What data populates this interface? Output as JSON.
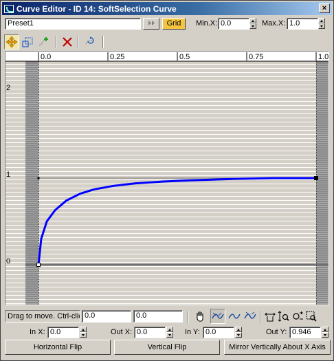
{
  "window": {
    "title": "Curve Editor - ID 14: SoftSelection Curve",
    "close_label": "×"
  },
  "top": {
    "preset": "Preset1",
    "grid_label": "Grid",
    "minx_label": "Min.X:",
    "minx_value": "0.0",
    "maxx_label": "Max.X:",
    "maxx_value": "1.0"
  },
  "toolbar": {
    "icons": [
      "move-icon",
      "scale-icon",
      "add-point-icon",
      "delete-icon",
      "reset-icon"
    ]
  },
  "graph": {
    "ruler_ticks": [
      "0.0",
      "0.25",
      "0.5",
      "0.75",
      "1.0"
    ],
    "y_labels": [
      "2",
      "1",
      "0"
    ],
    "curve_color": "#0000ff"
  },
  "chart_data": {
    "type": "line",
    "title": "",
    "xlabel": "",
    "ylabel": "",
    "xlim": [
      0,
      1
    ],
    "ylim": [
      -0.2,
      2.3
    ],
    "x_ticks": [
      "0.0",
      "0.25",
      "0.5",
      "0.75",
      "1.0"
    ],
    "y_ticks": [
      "0",
      "1",
      "2"
    ],
    "series": [
      {
        "x": [
          0,
          0.01,
          0.03,
          0.06,
          0.1,
          0.15,
          0.2,
          0.27,
          0.35,
          0.45,
          0.55,
          0.7,
          0.85,
          1.0
        ],
        "y": [
          0,
          0.3,
          0.5,
          0.63,
          0.74,
          0.82,
          0.87,
          0.91,
          0.94,
          0.96,
          0.975,
          0.99,
          1.0,
          1.0
        ]
      }
    ],
    "grid": true
  },
  "status": {
    "hint": "Drag to move. Ctrl-clic",
    "field1": "0.0",
    "field2": "0.0"
  },
  "points": {
    "inx_label": "In X:",
    "inx_value": "0.0",
    "outx_label": "Out X:",
    "outx_value": "0.0",
    "iny_label": "In Y:",
    "iny_value": "0.0",
    "outy_label": "Out Y:",
    "outy_value": "0.946"
  },
  "buttons": {
    "hflip": "Horizontal Flip",
    "vflip": "Vertical Flip",
    "mirror": "Mirror Vertically About X Axis"
  }
}
